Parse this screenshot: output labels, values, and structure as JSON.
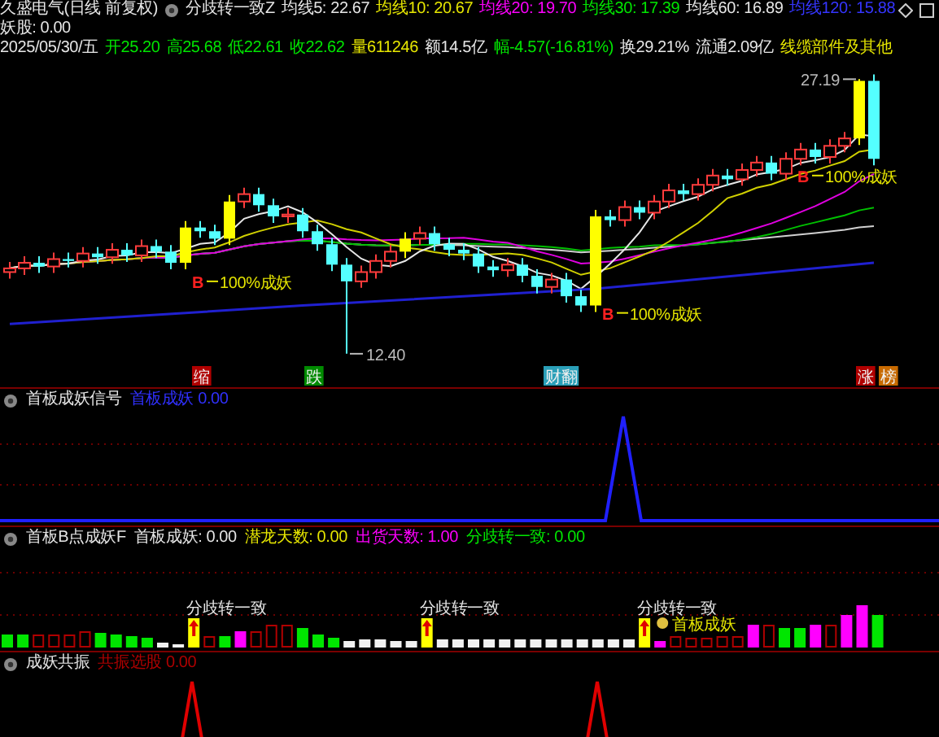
{
  "header": {
    "title": "久盛电气(日线 前复权)",
    "indicator": "分歧转一致Z",
    "readings": [
      {
        "text": "均线5: 22.67",
        "color": "#e6e6e6"
      },
      {
        "text": "均线10: 20.67",
        "color": "#e6e600"
      },
      {
        "text": "均线20: 19.70",
        "color": "#ff00ff"
      },
      {
        "text": "均线30: 17.39",
        "color": "#00e600"
      },
      {
        "text": "均线60: 16.89",
        "color": "#e6e6e6"
      },
      {
        "text": "均线120: 15.88",
        "color": "#3535ff"
      },
      {
        "text": "妖股: 0.00",
        "color": "#e6e6e6"
      }
    ]
  },
  "quote": {
    "items": [
      {
        "text": "2025/05/30/五",
        "color": "#e6e6e6"
      },
      {
        "text": "开25.20",
        "color": "#00e600"
      },
      {
        "text": "高25.68",
        "color": "#00e600"
      },
      {
        "text": "低22.61",
        "color": "#00e600"
      },
      {
        "text": "收22.62",
        "color": "#00e600"
      },
      {
        "text": "量611246",
        "color": "#e6e600"
      },
      {
        "text": "额14.5亿",
        "color": "#e6e6e6"
      },
      {
        "text": "幅-4.57(-16.81%)",
        "color": "#00e600"
      },
      {
        "text": "换29.21%",
        "color": "#e6e6e6"
      },
      {
        "text": "流通2.09亿",
        "color": "#e6e6e6"
      },
      {
        "text": "线缆部件及其他",
        "color": "#e6e600"
      }
    ]
  },
  "main_chart": {
    "price_labels": [
      "27.19",
      "12.40"
    ],
    "signals": [
      {
        "marker": "B",
        "text": "100%成妖"
      },
      {
        "marker": "B",
        "text": "100%成妖"
      },
      {
        "marker": "B",
        "text": "100%成妖"
      }
    ],
    "event_tags": [
      {
        "text": "缩",
        "color": "#b00000"
      },
      {
        "text": "跌",
        "color": "#008a00"
      },
      {
        "text": "财翻",
        "color": "#2a9fb8"
      },
      {
        "text": "涨",
        "color": "#b00000"
      },
      {
        "text": "榜",
        "color": "#c86a00"
      }
    ]
  },
  "panels": [
    {
      "title": "首板成妖信号",
      "readings": [
        {
          "text": "首板成妖 0.00",
          "color": "#3030ff"
        }
      ]
    },
    {
      "title": "首板B点成妖F",
      "readings": [
        {
          "text": "首板成妖: 0.00",
          "color": "#e6e6e6"
        },
        {
          "text": "潜龙天数: 0.00",
          "color": "#e6e600"
        },
        {
          "text": "出货天数: 1.00",
          "color": "#ff00ff"
        },
        {
          "text": "分歧转一致: 0.00",
          "color": "#00e600"
        }
      ]
    },
    {
      "title": "成妖共振",
      "readings": [
        {
          "text": "共振选股 0.00",
          "color": "#b00000"
        }
      ]
    }
  ],
  "bar_labels": [
    {
      "kind": "convergence",
      "text": "分歧转一致"
    },
    {
      "kind": "convergence",
      "text": "分歧转一致"
    },
    {
      "kind": "convergence",
      "text": "分歧转一致"
    },
    {
      "kind": "first_board",
      "text": "首板成妖"
    }
  ]
}
